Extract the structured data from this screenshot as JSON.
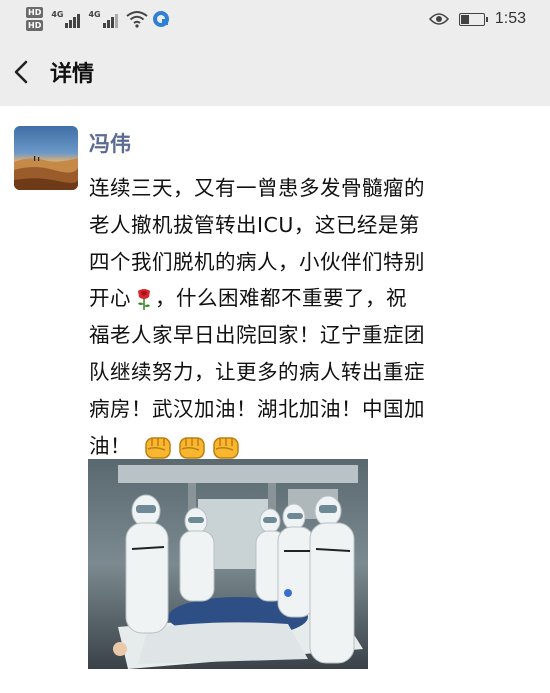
{
  "status_bar": {
    "sim1": "HD",
    "sim2": "HD",
    "network1": "4G",
    "network2": "4G",
    "time": "1:53",
    "battery_level": 0.35,
    "icons": [
      "hd-icon",
      "signal-icon",
      "wifi-icon",
      "cloud-icon",
      "eye-icon",
      "battery-icon"
    ]
  },
  "nav": {
    "title": "详情",
    "back_icon": "chevron-left-icon"
  },
  "post": {
    "author": "冯伟",
    "lines": [
      "连续三天，又有一曾患多发骨髓瘤的",
      "老人撤机拔管转出ICU，这已经是第",
      "四个我们脱机的病人，小伙伴们特别",
      "开心",
      "，什么困难都不重要了，祝",
      "福老人家早日出院回家！辽宁重症团",
      "队继续努力，让更多的病人转出重症",
      "病房！武汉加油！湖北加油！中国加",
      "油！"
    ],
    "emoji_rose": "rose-icon",
    "emoji_fist": "fist-icon"
  },
  "colors": {
    "bar_bg": "#ededed",
    "author": "#5b6b92"
  }
}
